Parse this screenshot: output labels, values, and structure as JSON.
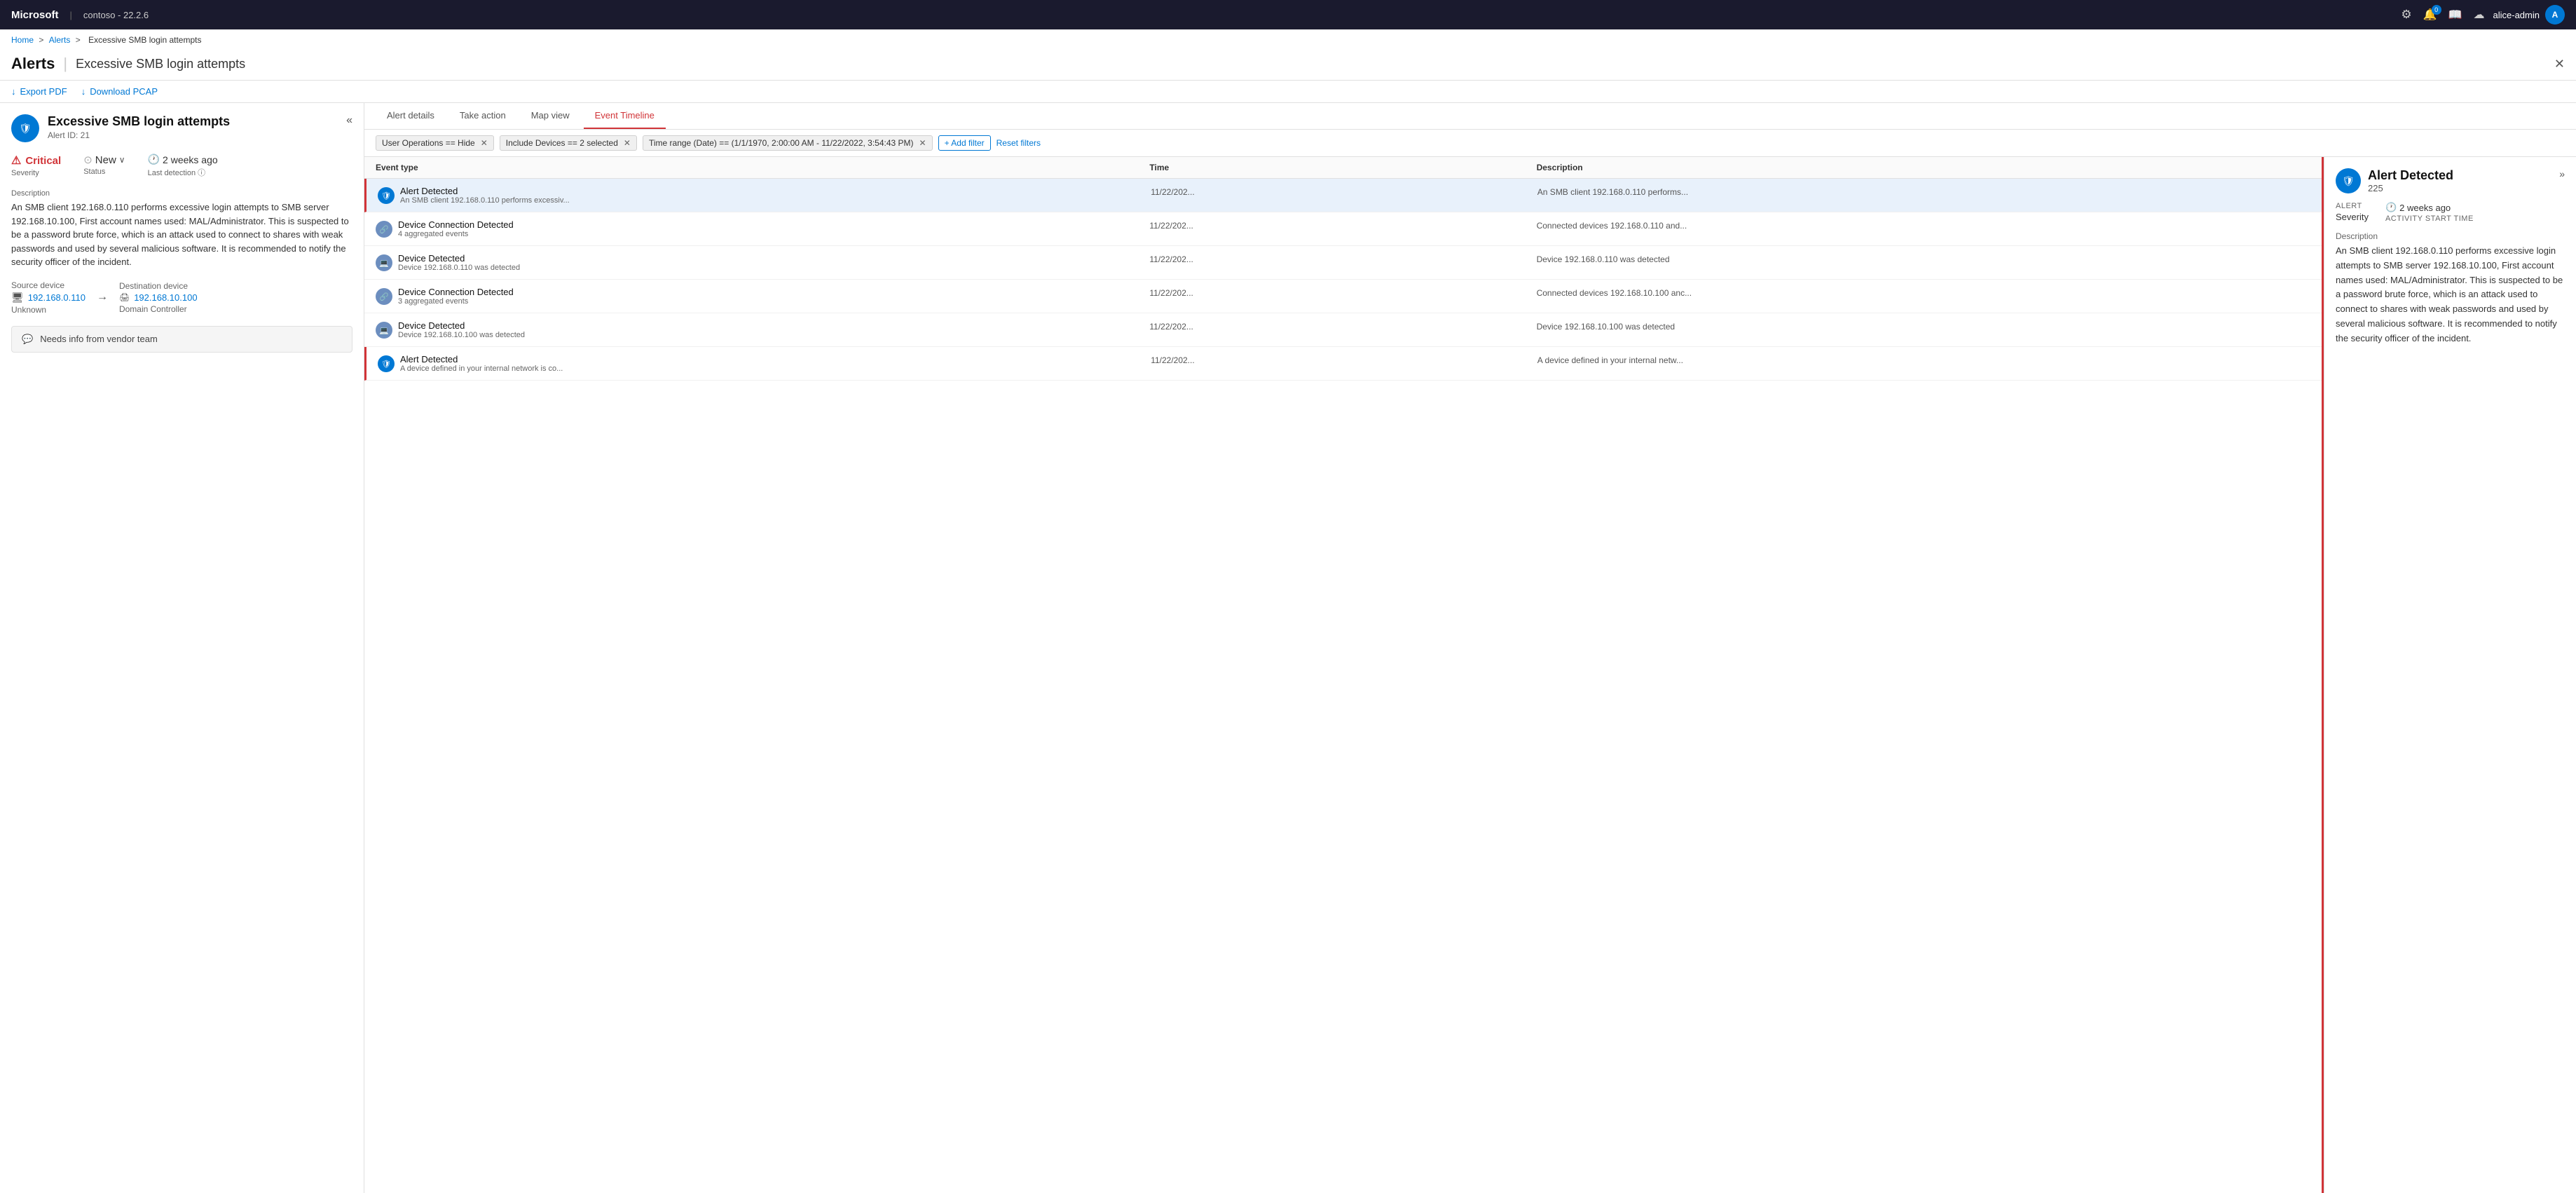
{
  "topbar": {
    "brand": "Microsoft",
    "separator": "|",
    "version": "contoso - 22.2.6",
    "settings_icon": "⚙",
    "bell_icon": "🔔",
    "bell_badge": "0",
    "book_icon": "📖",
    "cloud_icon": "☁",
    "username": "alice-admin",
    "avatar_initials": "A"
  },
  "breadcrumb": {
    "home": "Home",
    "alerts": "Alerts",
    "current": "Excessive SMB login attempts"
  },
  "page": {
    "title": "Alerts",
    "separator": "|",
    "subtitle": "Excessive SMB login attempts",
    "close_icon": "✕"
  },
  "toolbar": {
    "export_pdf": "Export PDF",
    "download_pcap": "Download PCAP",
    "export_icon": "↓",
    "download_icon": "↓"
  },
  "left_panel": {
    "alert_title": "Excessive SMB login attempts",
    "alert_id": "Alert ID: 21",
    "collapse_icon": "«",
    "severity_label": "Severity",
    "severity_value": "Critical",
    "status_label": "Status",
    "status_value": "New",
    "status_chevron": "∨",
    "last_detection_label": "Last detection",
    "last_detection_value": "2 weeks ago",
    "description_label": "Description",
    "description_text": "An SMB client 192.168.0.110 performs excessive login attempts to SMB server 192.168.10.100, First account names used: MAL/Administrator. This is suspected to be a password brute force, which is an attack used to connect to shares with weak passwords and used by several malicious software. It is recommended to notify the security officer of the incident.",
    "source_device_label": "Source device",
    "source_ip": "192.168.0.110",
    "source_type": "Unknown",
    "dest_device_label": "Destination device",
    "dest_ip": "192.168.10.100",
    "dest_type": "Domain Controller",
    "notes_text": "Needs info from vendor team"
  },
  "tabs": [
    {
      "id": "alert-details",
      "label": "Alert details",
      "active": false
    },
    {
      "id": "take-action",
      "label": "Take action",
      "active": false
    },
    {
      "id": "map-view",
      "label": "Map view",
      "active": false
    },
    {
      "id": "event-timeline",
      "label": "Event Timeline",
      "active": true
    }
  ],
  "filters": {
    "filter1": "User Operations == Hide",
    "filter2": "Include Devices == 2 selected",
    "filter3": "Time range (Date) == (1/1/1970, 2:00:00 AM - 11/22/2022, 3:54:43 PM)",
    "add_filter_label": "+ Add filter",
    "reset_filters_label": "Reset filters"
  },
  "event_table": {
    "headers": [
      "Event type",
      "Time",
      "Description"
    ],
    "rows": [
      {
        "type": "alert",
        "title": "Alert Detected",
        "subtitle": "An SMB client 192.168.0.110 performs excessiv...",
        "time": "11/22/202...",
        "desc": "An SMB client 192.168.0.110 performs...",
        "selected": true,
        "alert_border": true
      },
      {
        "type": "device",
        "title": "Device Connection Detected",
        "subtitle": "4 aggregated events",
        "time": "11/22/202...",
        "desc": "Connected devices 192.168.0.110 and...",
        "selected": false,
        "alert_border": false
      },
      {
        "type": "device",
        "title": "Device Detected",
        "subtitle": "Device 192.168.0.110 was detected",
        "time": "11/22/202...",
        "desc": "Device 192.168.0.110 was detected",
        "selected": false,
        "alert_border": false
      },
      {
        "type": "device",
        "title": "Device Connection Detected",
        "subtitle": "3 aggregated events",
        "time": "11/22/202...",
        "desc": "Connected devices 192.168.10.100 anc...",
        "selected": false,
        "alert_border": false
      },
      {
        "type": "device",
        "title": "Device Detected",
        "subtitle": "Device 192.168.10.100 was detected",
        "time": "11/22/202...",
        "desc": "Device 192.168.10.100 was detected",
        "selected": false,
        "alert_border": false
      },
      {
        "type": "alert",
        "title": "Alert Detected",
        "subtitle": "A device defined in your internal network is co...",
        "time": "11/22/202...",
        "desc": "A device defined in your internal netw...",
        "selected": false,
        "alert_border": true
      }
    ]
  },
  "detail_panel": {
    "title": "Alert Detected",
    "number": "225",
    "expand_icon": "»",
    "severity_label": "ALERT",
    "severity_sublabel": "Severity",
    "time_label": "Activity start time",
    "time_value": "2 weeks ago",
    "description_label": "Description",
    "description_text": "An SMB client 192.168.0.110 performs excessive login attempts to SMB server 192.168.10.100, First account names used: MAL/Administrator. This is suspected to be a password brute force, which is an attack used to connect to shares with weak passwords and used by several malicious software. It is recommended to notify the security officer of the incident."
  }
}
